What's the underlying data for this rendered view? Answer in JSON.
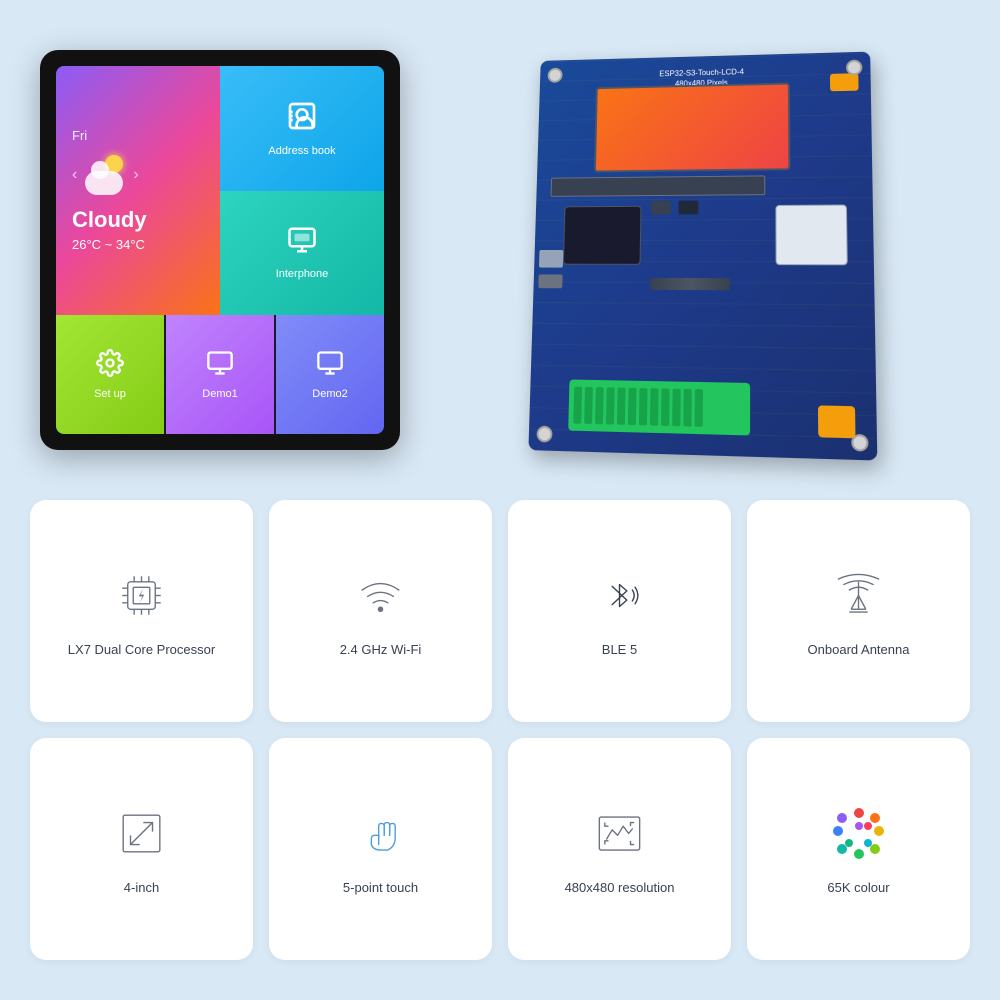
{
  "background_color": "#d8e8f5",
  "lcd": {
    "day": "Fri",
    "weather_name": "Cloudy",
    "weather_temp": "26°C ~ 34°C",
    "address_book_label": "Address book",
    "interphone_label": "Interphone",
    "setup_label": "Set up",
    "demo1_label": "Demo1",
    "demo2_label": "Demo2"
  },
  "pcb": {
    "model": "ESP32-S3-Touch-LCD-4",
    "resolution": "480x480 Pixels"
  },
  "features": [
    {
      "id": "processor",
      "label": "LX7 Dual Core Processor",
      "icon": "cpu"
    },
    {
      "id": "wifi",
      "label": "2.4 GHz Wi-Fi",
      "icon": "wifi"
    },
    {
      "id": "ble",
      "label": "BLE 5",
      "icon": "bluetooth"
    },
    {
      "id": "antenna",
      "label": "Onboard Antenna",
      "icon": "antenna"
    },
    {
      "id": "size",
      "label": "4-inch",
      "icon": "resize"
    },
    {
      "id": "touch",
      "label": "5-point touch",
      "icon": "hand"
    },
    {
      "id": "resolution",
      "label": "480x480 resolution",
      "icon": "resolution"
    },
    {
      "id": "colour",
      "label": "65K colour",
      "icon": "colorwheel"
    }
  ]
}
